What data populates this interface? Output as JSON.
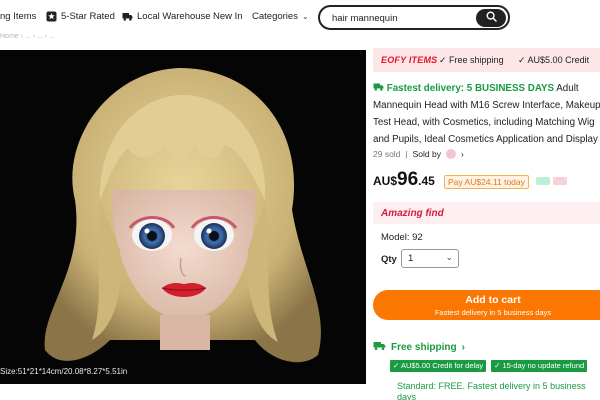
{
  "nav": {
    "items": [
      {
        "label": "ng Items",
        "icon": "none"
      },
      {
        "label": "5-Star Rated",
        "icon": "star-badge-icon"
      },
      {
        "label": "Local Warehouse",
        "icon": "truck-icon"
      },
      {
        "label": "New In",
        "icon": "none"
      },
      {
        "label": "Categories",
        "icon": "chevron-down-icon"
      }
    ]
  },
  "search": {
    "value": "hair mannequin",
    "placeholder": "hair mannequin"
  },
  "breadcrumb": "Home › ... › ... › ...",
  "image": {
    "size_label": "Size:51*21*14cm/20.08*8.27*5.51in"
  },
  "banner": {
    "logo": "EOFY ITEMS",
    "free_shipping": "✓ Free shipping",
    "credit": "✓ AU$5.00 Credit"
  },
  "product": {
    "fast_label": "Fastest delivery: 5 BUSINESS DAYS",
    "title_rest": " Adult Mannequin Head with M16 Screw Interface, Makeup Test Head, with Cosmetics, including Matching Wig and Pupils, Ideal Cosmetics Application and Display",
    "sold": "29 sold",
    "sold_by": "Sold by"
  },
  "price": {
    "currency": "AU$",
    "integer": "96",
    "decimal": ".45",
    "pay_label": "Pay AU$24.11 today"
  },
  "amazing": {
    "title": "Amazing find",
    "model": "Model: 92",
    "qty_label": "Qty",
    "qty_value": "1"
  },
  "cart": {
    "label": "Add to cart",
    "sub": "Fastest delivery in 5 business days"
  },
  "shipping": {
    "title": "Free shipping",
    "tags": [
      "✓ AU$5.00 Credit for delay",
      "✓ 15-day no update refund"
    ],
    "standard": "Standard: FREE. Fastest delivery in 5 business days"
  },
  "colors": {
    "accent": "#fb7701",
    "green": "#1a9b42",
    "red": "#e8122a"
  }
}
